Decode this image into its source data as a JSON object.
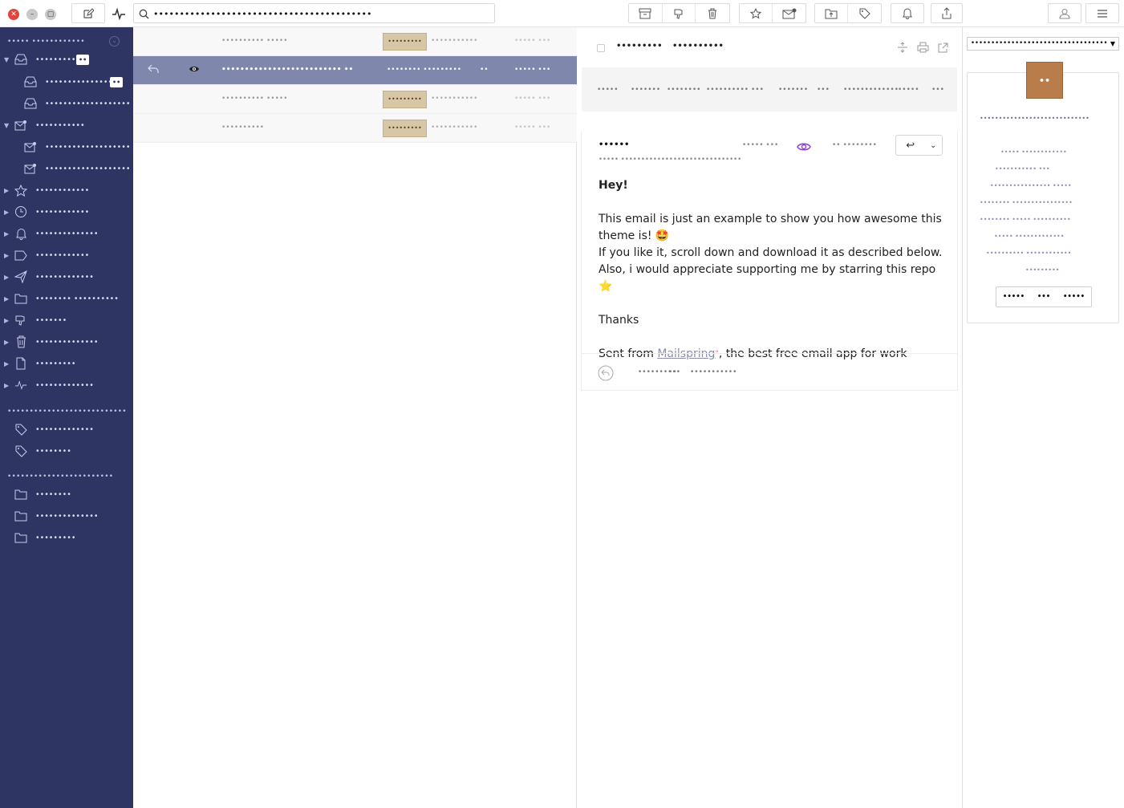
{
  "toolbar": {
    "search_value": "••••••••••••••••••••••••••••••••••••••••••",
    "icons": [
      "compose-icon",
      "activity-icon",
      "archive-icon",
      "spam-icon",
      "trash-icon",
      "star-icon",
      "unread-icon",
      "move-icon",
      "label-icon",
      "snooze-icon",
      "share-icon",
      "account-icon",
      "menu-icon"
    ]
  },
  "sidebar": {
    "header1": "••••• ••••••••••••",
    "header2": "•••••••••••••••••••••••••••",
    "header3": "••••••••••••••••••••••••",
    "items": [
      {
        "label": "••••••••••••",
        "badge": "••"
      },
      {
        "label": "•••••••••••••••",
        "badge": "••"
      },
      {
        "label": "•••••••••••••••••••"
      },
      {
        "label": "•••••••••••"
      },
      {
        "label": "•••••••••••••••••••"
      },
      {
        "label": "•••••••••••••••••••"
      },
      {
        "label": "••••••••••••"
      },
      {
        "label": "••••••••••••"
      },
      {
        "label": "••••••••••••••"
      },
      {
        "label": "••••••••••••"
      },
      {
        "label": "•••••••••••••"
      },
      {
        "label": "•••••••• ••••••••••"
      },
      {
        "label": "•••••••"
      },
      {
        "label": "••••••••••••••"
      },
      {
        "label": "•••••••••"
      },
      {
        "label": "•••••••••••••"
      },
      {
        "label": "•••••••••••••"
      },
      {
        "label": "••••••••"
      },
      {
        "label": "••••••••"
      },
      {
        "label": "••••••••••••••"
      },
      {
        "label": "•••••••••"
      }
    ]
  },
  "messages": [
    {
      "sender": "•••••••••• •••••",
      "tag": "•••••••••",
      "subject": "•••••••••••",
      "date": "••••• •••"
    },
    {
      "sender": "••••••••••••••••••••••••••  ••",
      "tag": "•••••••• •••••••••",
      "subject": "••",
      "date": "••••• •••"
    },
    {
      "sender": "•••••••••• •••••",
      "tag": "•••••••••",
      "subject": "•••••••••••",
      "date": "••••• •••"
    },
    {
      "sender": "••••••••••",
      "tag": "•••••••••",
      "subject": "•••••••••••",
      "date": "••••• •••"
    }
  ],
  "reader": {
    "subject_a": "•••••••••",
    "subject_b": "••••••••••",
    "participants": [
      "•••••",
      "•••••••",
      "••••••••",
      "••••••••••",
      "•••",
      "•••••••",
      "•••",
      "•••••••••••••",
      "•••••",
      "•••"
    ],
    "from": "••••••",
    "to": "••••• ••••••••••••••••••••••••••••••",
    "meta_a": "••••• •••",
    "meta_b": "•• ••••••••",
    "body": {
      "greeting": "Hey!",
      "line1": "This email is just an example to show you how awesome this theme is! 🤩",
      "line2": "If you like it,  scroll down and download it as described below.",
      "line3": "Also, i would appreciate supporting me by starring this repo ⭐",
      "thanks": "Thanks",
      "sent_prefix": "Sent from ",
      "sent_link": "Mailspring",
      "sent_suffix": ", the best free email app for work"
    },
    "footer_a": "••••••••••",
    "footer_b": "••",
    "footer_c": "•••••••••••"
  },
  "sidepanel": {
    "select_value": "••••••••••••••••••••••••••••••••••",
    "avatar_text": "••",
    "name": "•••••••••••••••••••••••••••••",
    "lines": [
      "•••••  ••••••••••••",
      "•••••••••••  •••",
      "••••••••••••••••  •••••",
      "••••••••  ••••••••••••••••",
      "••••••••  •••••  ••••••••••",
      "•••••  •••••••••••••",
      "••••••••••  ••••••••••••",
      "•••••••••"
    ],
    "tabs": [
      "•••••",
      "•••",
      "•••••"
    ]
  }
}
